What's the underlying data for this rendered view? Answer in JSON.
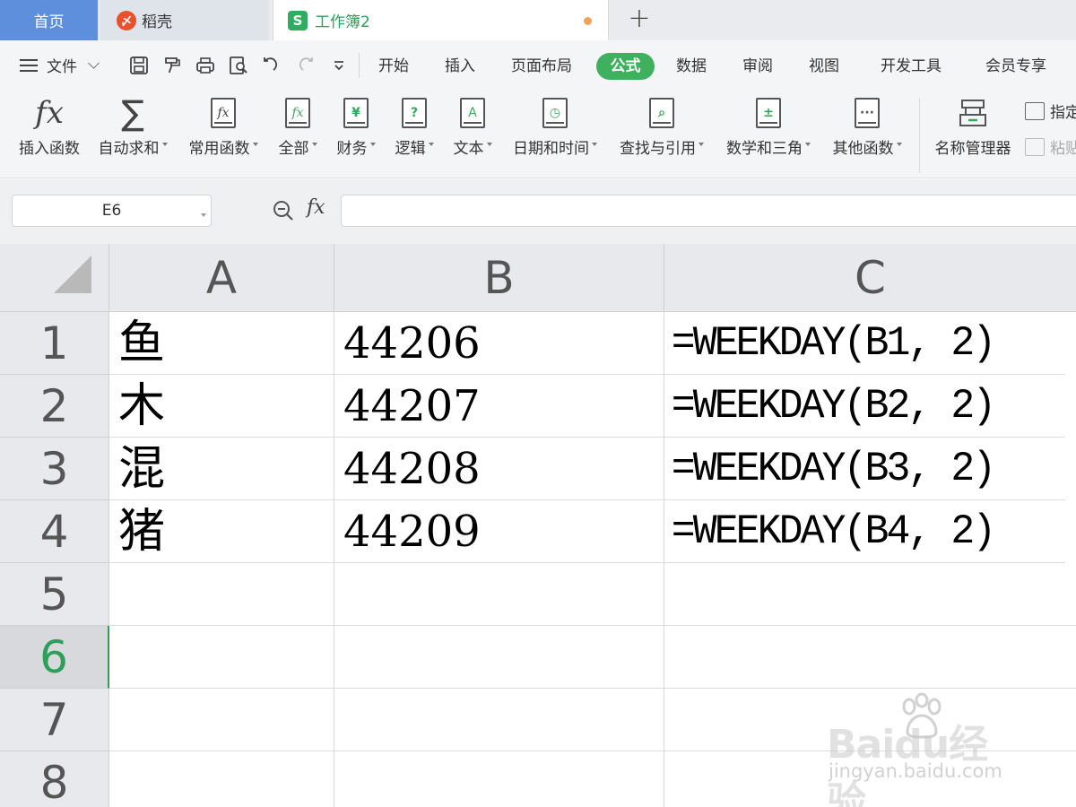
{
  "tabs": {
    "home": "首页",
    "daoke": "稻壳",
    "workbook": "工作簿2",
    "daoke_logo_glyph": "〆",
    "workbook_logo_glyph": "S",
    "new_tab": "+"
  },
  "menu": {
    "file": "文件",
    "items": [
      "开始",
      "插入",
      "页面布局",
      "公式",
      "数据",
      "审阅",
      "视图",
      "开发工具",
      "会员专享"
    ],
    "active": "公式"
  },
  "ribbon": {
    "buttons": [
      {
        "label": "插入函数",
        "icon": "fx-icon",
        "glyph": "fx",
        "dropdown": false
      },
      {
        "label": "自动求和",
        "icon": "sum-icon",
        "glyph": "∑",
        "dropdown": true
      },
      {
        "label": "常用函数",
        "icon": "common-function-icon",
        "glyph": "fx",
        "dropdown": true
      },
      {
        "label": "全部",
        "icon": "all-functions-icon",
        "glyph": "fx",
        "dropdown": true
      },
      {
        "label": "财务",
        "icon": "finance-icon",
        "glyph": "¥",
        "dropdown": true
      },
      {
        "label": "逻辑",
        "icon": "logic-icon",
        "glyph": "?",
        "dropdown": true
      },
      {
        "label": "文本",
        "icon": "text-icon",
        "glyph": "A",
        "dropdown": true
      },
      {
        "label": "日期和时间",
        "icon": "date-time-icon",
        "glyph": "◷",
        "dropdown": true
      },
      {
        "label": "查找与引用",
        "icon": "lookup-icon",
        "glyph": "⌕",
        "dropdown": true
      },
      {
        "label": "数学和三角",
        "icon": "math-trig-icon",
        "glyph": "±",
        "dropdown": true
      },
      {
        "label": "其他函数",
        "icon": "other-functions-icon",
        "glyph": "···",
        "dropdown": true
      },
      {
        "label": "名称管理器",
        "icon": "name-manager-icon",
        "glyph": "",
        "dropdown": false
      }
    ],
    "small": [
      {
        "label": "指定",
        "icon": "specify-icon"
      },
      {
        "label": "粘贴",
        "icon": "paste-icon"
      }
    ]
  },
  "formula_bar": {
    "name_box": "E6",
    "fx_label": "fx",
    "value": ""
  },
  "sheet": {
    "columns": [
      "A",
      "B",
      "C"
    ],
    "rows": [
      "1",
      "2",
      "3",
      "4",
      "5",
      "6",
      "7",
      "8"
    ],
    "active_row": "6",
    "cells": [
      [
        "鱼",
        "44206",
        "=WEEKDAY(B1, 2)"
      ],
      [
        "木",
        "44207",
        "=WEEKDAY(B2, 2)"
      ],
      [
        "混",
        "44208",
        "=WEEKDAY(B3, 2)"
      ],
      [
        "猪",
        "44209",
        "=WEEKDAY(B4, 2)"
      ],
      [
        "",
        "",
        ""
      ],
      [
        "",
        "",
        ""
      ],
      [
        "",
        "",
        ""
      ],
      [
        "",
        "",
        ""
      ]
    ]
  },
  "watermark": {
    "main": "Baidu经验",
    "sub": "jingyan.baidu.com"
  },
  "colors": {
    "accent_green": "#3fb15e",
    "home_tab_blue": "#5d8fdc",
    "dirty_dot": "#f0a35a"
  }
}
